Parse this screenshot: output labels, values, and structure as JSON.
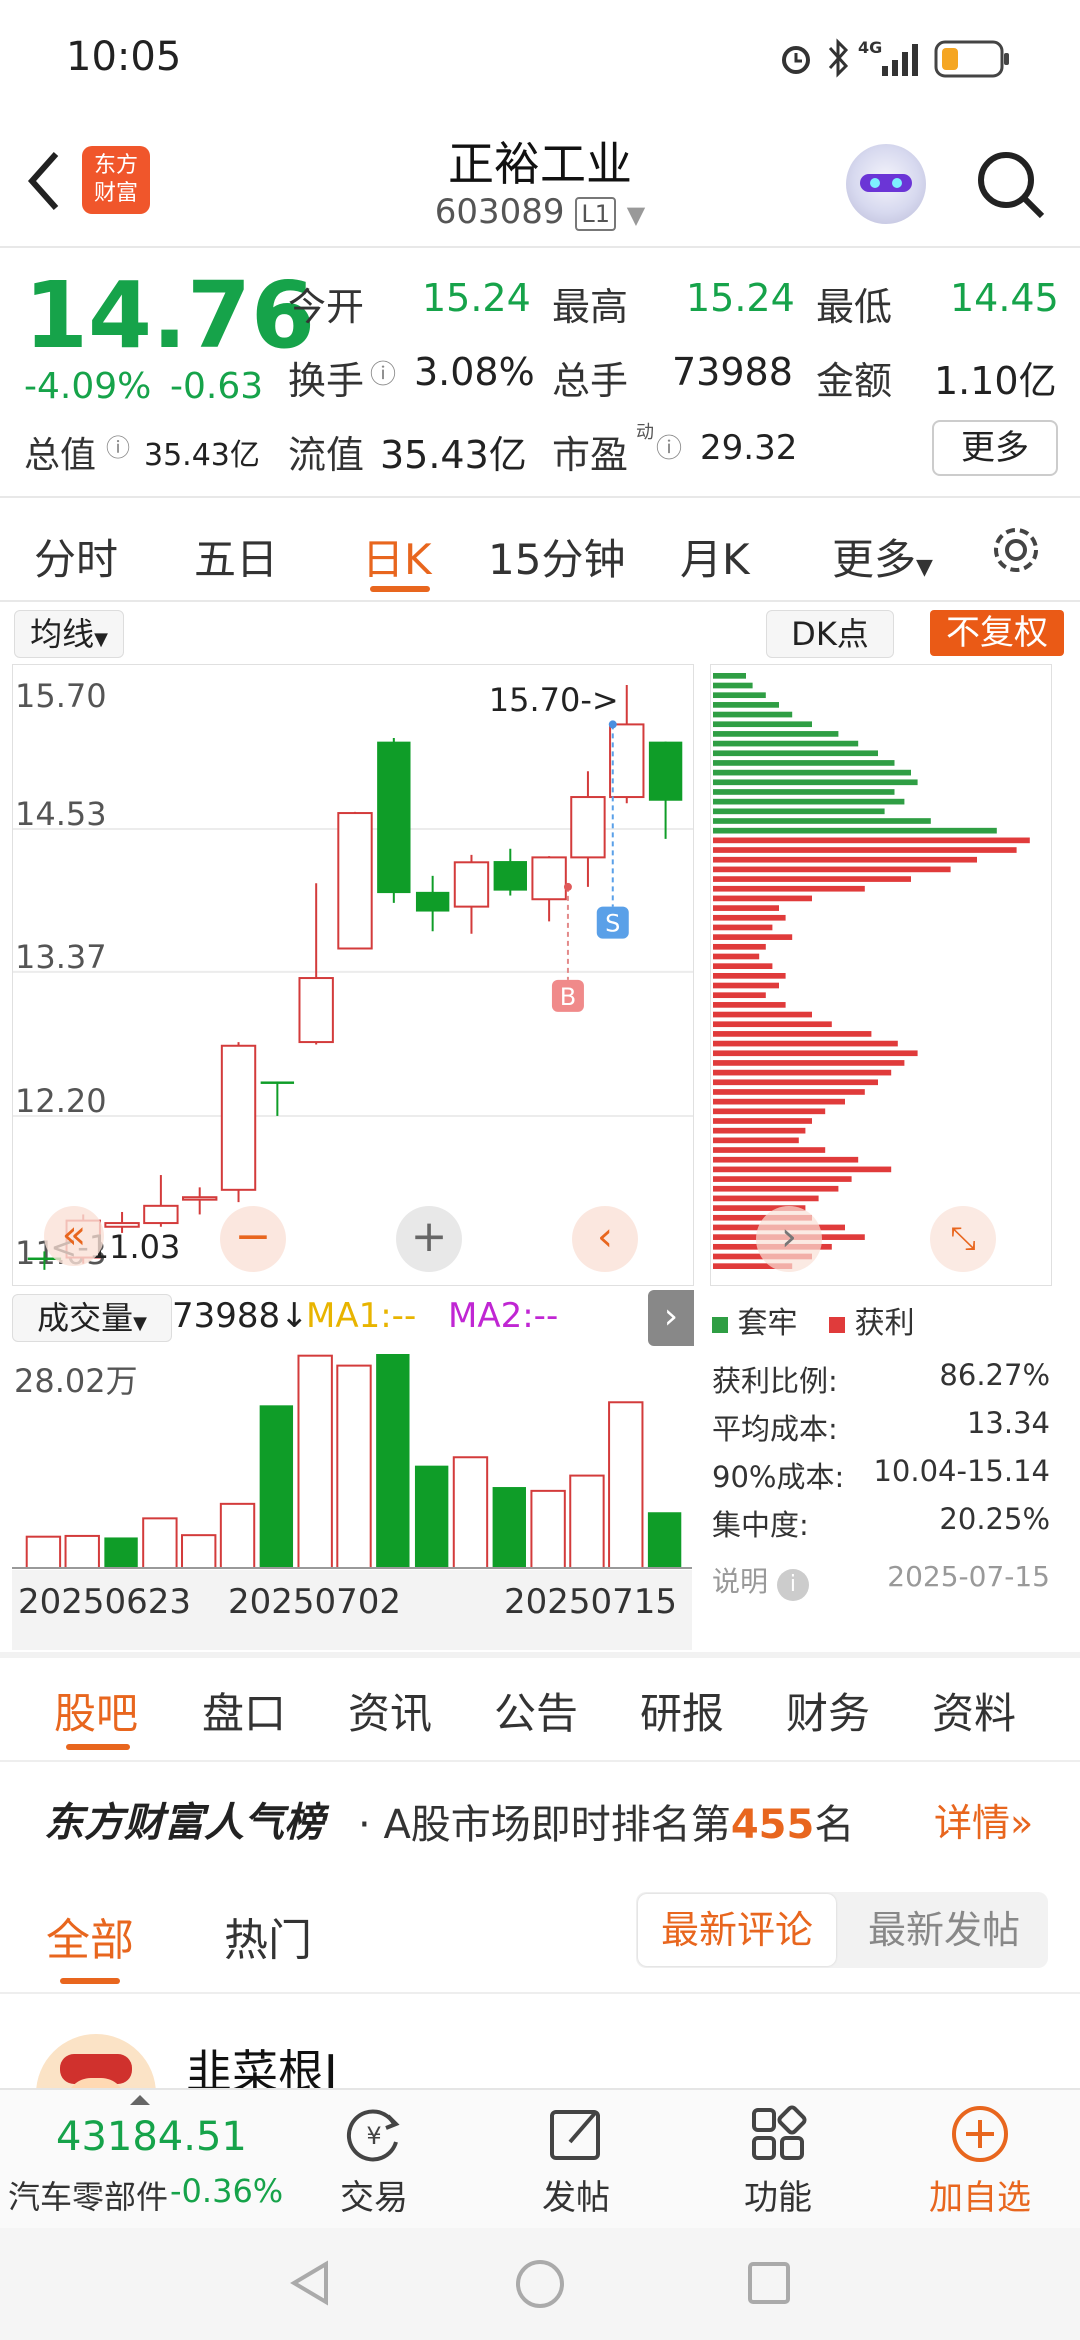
{
  "status": {
    "time": "10:05",
    "network": "4G"
  },
  "header": {
    "title": "正裕工业",
    "code": "603089",
    "level": "L1",
    "logo_line1": "东方",
    "logo_line2": "财富"
  },
  "quote": {
    "price": "14.76",
    "change_pct": "-4.09%",
    "change": "-0.63",
    "open_label": "今开",
    "open": "15.24",
    "high_label": "最高",
    "high": "15.24",
    "low_label": "最低",
    "low": "14.45",
    "turnover_label": "换手",
    "turnover": "3.08%",
    "volume_label": "总手",
    "volume": "73988",
    "amount_label": "金额",
    "amount": "1.10亿",
    "mktcap_label": "总值",
    "mktcap": "35.43亿",
    "float_label": "流值",
    "float_cap": "35.43亿",
    "pe_label": "市盈",
    "pe_sup": "动",
    "pe": "29.32",
    "more": "更多"
  },
  "ktabs": [
    "分时",
    "五日",
    "日K",
    "15分钟",
    "月K",
    "更多"
  ],
  "chart_controls": {
    "ma": "均线",
    "dk": "DK点",
    "adjust": "不复权"
  },
  "chart_data": {
    "type": "candlestick",
    "y_ticks": [
      "15.70",
      "14.53",
      "13.37",
      "12.20",
      "11.03"
    ],
    "ylim": [
      11.03,
      15.7
    ],
    "high_marker": "15.70->",
    "low_marker": "<-11.03",
    "candles": [
      {
        "o": 11.05,
        "c": 11.03,
        "h": 11.1,
        "l": 10.95
      },
      {
        "o": 11.05,
        "c": 11.35,
        "h": 11.4,
        "l": 11.0
      },
      {
        "o": 11.3,
        "c": 11.33,
        "h": 11.42,
        "l": 11.25
      },
      {
        "o": 11.33,
        "c": 11.47,
        "h": 11.72,
        "l": 11.3
      },
      {
        "o": 11.52,
        "c": 11.54,
        "h": 11.62,
        "l": 11.4
      },
      {
        "o": 11.6,
        "c": 12.77,
        "h": 12.8,
        "l": 11.5
      },
      {
        "o": 12.48,
        "c": 12.46,
        "h": 12.48,
        "l": 12.2
      },
      {
        "o": 12.8,
        "c": 13.32,
        "h": 14.09,
        "l": 12.78
      },
      {
        "o": 13.56,
        "c": 14.66,
        "h": 14.67,
        "l": 13.56
      },
      {
        "o": 15.24,
        "c": 14.01,
        "h": 15.27,
        "l": 13.93
      },
      {
        "o": 14.02,
        "c": 13.86,
        "h": 14.15,
        "l": 13.7
      },
      {
        "o": 13.9,
        "c": 14.26,
        "h": 14.32,
        "l": 13.68
      },
      {
        "o": 14.27,
        "c": 14.03,
        "h": 14.37,
        "l": 13.99
      },
      {
        "o": 13.96,
        "c": 14.3,
        "h": 14.31,
        "l": 13.78
      },
      {
        "o": 14.3,
        "c": 14.79,
        "h": 15.0,
        "l": 14.06
      },
      {
        "o": 14.79,
        "c": 15.38,
        "h": 15.7,
        "l": 14.74
      },
      {
        "o": 15.24,
        "c": 14.76,
        "h": 15.24,
        "l": 14.45
      }
    ],
    "buy_label": "B",
    "sell_label": "S",
    "volume_label": "成交量",
    "volume_value": "73988",
    "ma1": "MA1:--",
    "ma2": "MA2:--",
    "vol_max_label": "28.02万",
    "volumes": [
      {
        "v": 4.1,
        "up": true
      },
      {
        "v": 4.2,
        "up": true
      },
      {
        "v": 4.0,
        "up": false
      },
      {
        "v": 6.5,
        "up": true
      },
      {
        "v": 4.3,
        "up": true
      },
      {
        "v": 8.4,
        "up": true
      },
      {
        "v": 21.3,
        "up": false
      },
      {
        "v": 27.8,
        "up": true
      },
      {
        "v": 26.5,
        "up": true
      },
      {
        "v": 28.02,
        "up": false
      },
      {
        "v": 13.4,
        "up": false
      },
      {
        "v": 14.5,
        "up": true
      },
      {
        "v": 10.6,
        "up": false
      },
      {
        "v": 10.1,
        "up": true
      },
      {
        "v": 12.1,
        "up": true
      },
      {
        "v": 21.7,
        "up": true
      },
      {
        "v": 7.3,
        "up": false
      }
    ],
    "dates": [
      "20250623",
      "20250702",
      "20250715"
    ]
  },
  "chip_dist": {
    "legend_trapped": "套牢",
    "legend_profit": "获利",
    "stats": [
      {
        "label": "获利比例:",
        "value": "86.27%"
      },
      {
        "label": "平均成本:",
        "value": "13.34"
      },
      {
        "label": "90%成本:",
        "value": "10.04-15.14"
      },
      {
        "label": "集中度:",
        "value": "20.25%"
      }
    ],
    "note": "说明",
    "date": "2025-07-15",
    "bars": [
      0.1,
      0.12,
      0.16,
      0.2,
      0.24,
      0.3,
      0.38,
      0.44,
      0.5,
      0.55,
      0.6,
      0.62,
      0.55,
      0.58,
      0.52,
      0.66,
      0.86,
      0.96,
      0.92,
      0.8,
      0.72,
      0.6,
      0.46,
      0.3,
      0.2,
      0.22,
      0.18,
      0.24,
      0.16,
      0.14,
      0.18,
      0.22,
      0.2,
      0.16,
      0.22,
      0.3,
      0.36,
      0.48,
      0.56,
      0.62,
      0.58,
      0.54,
      0.5,
      0.46,
      0.4,
      0.34,
      0.3,
      0.28,
      0.26,
      0.34,
      0.44,
      0.54,
      0.42,
      0.38,
      0.32,
      0.28,
      0.3,
      0.4,
      0.46,
      0.36,
      0.3,
      0.24
    ],
    "green_rows": 17
  },
  "section_tabs": [
    "股吧",
    "盘口",
    "资讯",
    "公告",
    "研报",
    "财务",
    "资料"
  ],
  "ranking": {
    "brand": "东方财富人气榜",
    "text_prefix": "A股市场即时排名第",
    "rank": "455",
    "text_suffix": "名",
    "details": "详情"
  },
  "feed": {
    "tab_all": "全部",
    "tab_hot": "热门",
    "sort_new_comment": "最新评论",
    "sort_new_post": "最新发帖"
  },
  "post": {
    "user": "韭菜根I"
  },
  "bottom": {
    "index_value": "43184.51",
    "index_name": "汽车零部件",
    "index_change": "-0.36%",
    "trade": "交易",
    "post": "发帖",
    "func": "功能",
    "add": "加自选"
  }
}
